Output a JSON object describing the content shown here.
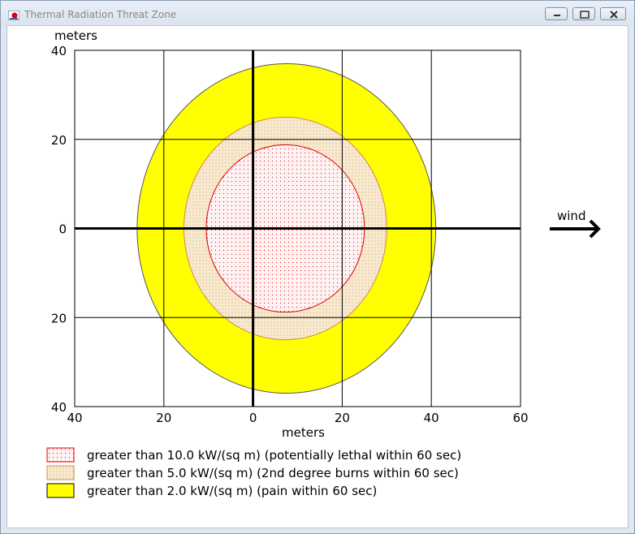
{
  "window": {
    "title": "Thermal Radiation Threat Zone"
  },
  "chart_data": {
    "type": "area",
    "axis_units": {
      "x": "meters",
      "y": "meters"
    },
    "xlim": [
      -40,
      60
    ],
    "ylim": [
      -40,
      40
    ],
    "x_ticks": [
      {
        "value": -40,
        "label": "40"
      },
      {
        "value": -20,
        "label": "20"
      },
      {
        "value": 0,
        "label": "0"
      },
      {
        "value": 20,
        "label": "20"
      },
      {
        "value": 40,
        "label": "40"
      },
      {
        "value": 60,
        "label": "60"
      }
    ],
    "y_ticks": [
      {
        "value": 40,
        "label": "40"
      },
      {
        "value": 20,
        "label": "20"
      },
      {
        "value": 0,
        "label": "0"
      },
      {
        "value": -20,
        "label": "20"
      },
      {
        "value": -40,
        "label": "40"
      }
    ],
    "grid": true,
    "wind_label": "wind",
    "zones": [
      {
        "name": "greater than 2.0 kW/(sq m) (pain within 60 sec)",
        "threshold": 2.0,
        "x_range": [
          -26,
          41
        ],
        "y_range": [
          -37,
          37
        ],
        "fill": "#ffff00",
        "stroke": "#555555",
        "pattern": "solid"
      },
      {
        "name": "greater than 5.0 kW/(sq m) (2nd degree burns within 60 sec)",
        "threshold": 5.0,
        "x_range": [
          -15.5,
          30
        ],
        "y_range": [
          -25,
          25
        ],
        "fill": "#f5e8c8",
        "stroke": "#d08a4a",
        "pattern": "dots-orange"
      },
      {
        "name": "greater than 10.0 kW/(sq m) (potentially lethal within 60 sec)",
        "threshold": 10.0,
        "x_range": [
          -10.5,
          25
        ],
        "y_range": [
          -18.8,
          18.8
        ],
        "fill": "#fff0f0",
        "stroke": "#dd0000",
        "pattern": "dots-red"
      }
    ],
    "legend_order": [
      2,
      1,
      0
    ]
  }
}
